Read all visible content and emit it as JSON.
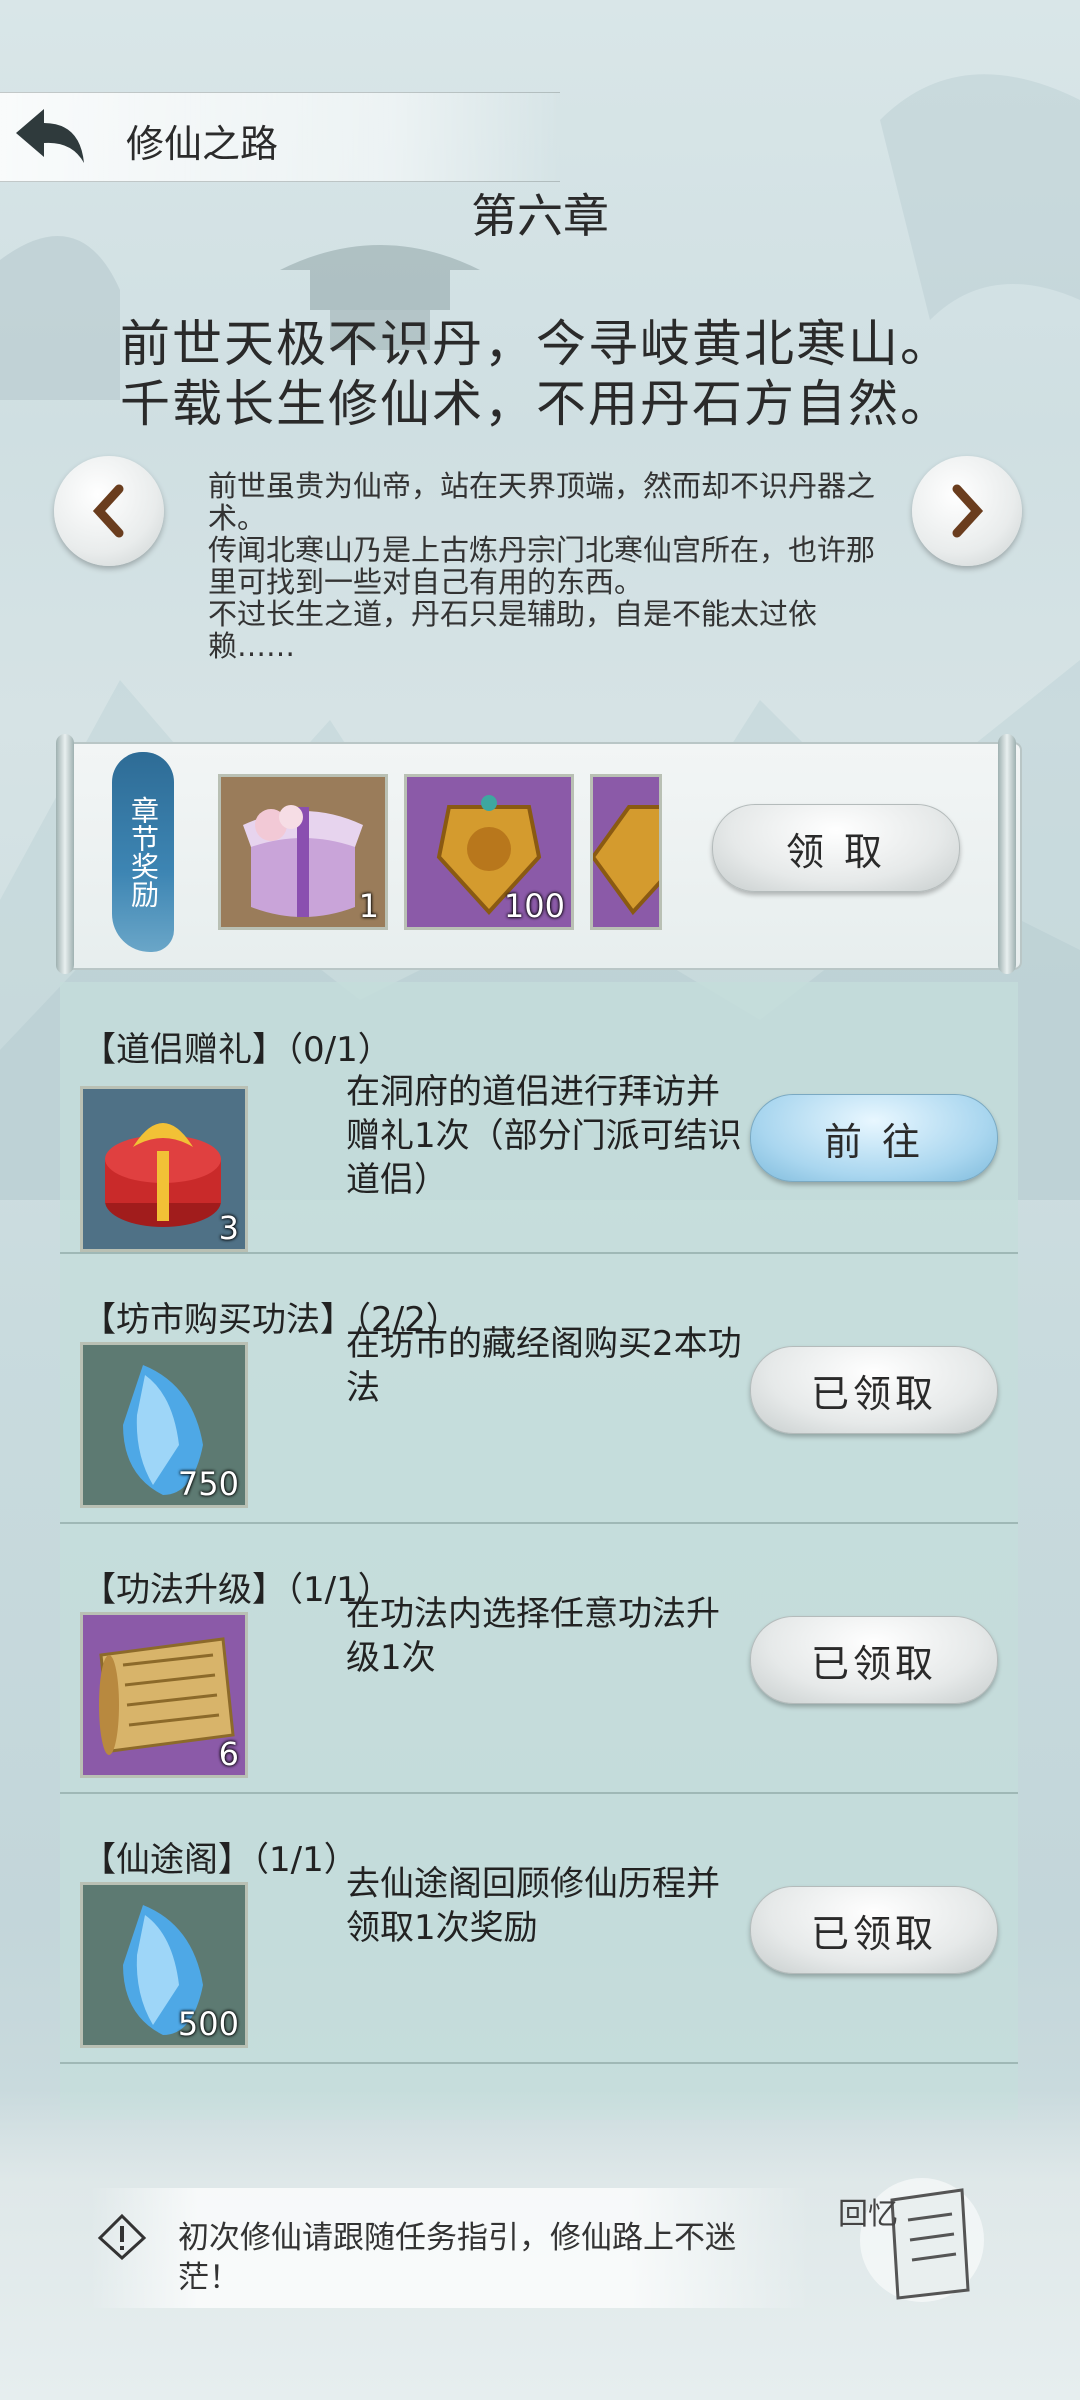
{
  "header": {
    "title": "修仙之路"
  },
  "chapter": {
    "title": "第六章",
    "poem": [
      "前世天极不识丹，今寻岐黄北寒山。",
      "千载长生修仙术，不用丹石方自然。"
    ],
    "story": [
      "前世虽贵为仙帝，站在天界顶端，然而却不识丹器之术。",
      "传闻北寒山乃是上古炼丹宗门北寒仙宫所在，也许那里可找到一些对自己有用的东西。",
      "不过长生之道，丹石只是辅助，自是不能太过依赖……"
    ]
  },
  "chapter_reward": {
    "tag": "章节奖励",
    "items": [
      {
        "icon": "gift-box-icon",
        "count": "1"
      },
      {
        "icon": "gold-badge-icon",
        "count": "100"
      },
      {
        "icon": "gold-badge-icon",
        "count": ""
      }
    ],
    "claim_label": "领 取"
  },
  "tasks": [
    {
      "title": "【道侣赠礼】（0/1）",
      "icon": "red-gift-icon",
      "count": "3",
      "desc": "在洞府的道侣进行拜访并赠礼1次（部分门派可结识道侣）",
      "button": "前 往"
    },
    {
      "title": "【坊市购买功法】（2/2）",
      "icon": "blue-crystal-icon",
      "count": "750",
      "desc": "在坊市的藏经阁购买2本功法",
      "button": "已领取"
    },
    {
      "title": "【功法升级】（1/1）",
      "icon": "scroll-icon",
      "count": "6",
      "desc": "在功法内选择任意功法升级1次",
      "button": "已领取"
    },
    {
      "title": "【仙途阁】（1/1）",
      "icon": "blue-crystal-icon",
      "count": "500",
      "desc": "去仙途阁回顾修仙历程并领取1次奖励",
      "button": "已领取"
    }
  ],
  "tip": {
    "text": "初次修仙请跟随任务指引，修仙路上不迷茫！"
  },
  "corner": {
    "label": "回忆"
  },
  "colors": {
    "accent_blue": "#3d85b3",
    "panel": "#c4dddb"
  }
}
